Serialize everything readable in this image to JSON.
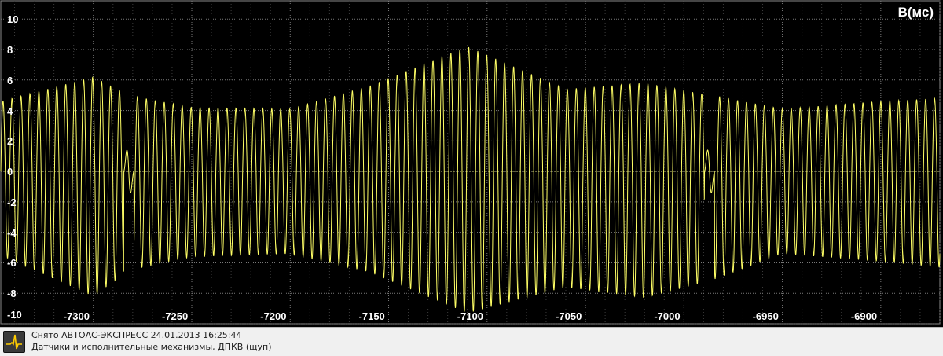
{
  "chart_data": {
    "type": "line",
    "unit_label": "В(мс)",
    "xlim": [
      -7347,
      -6870
    ],
    "ylim": [
      -10,
      11.2
    ],
    "y_ticks": [
      {
        "value": 10,
        "label": "10"
      },
      {
        "value": 8,
        "label": "8"
      },
      {
        "value": 6,
        "label": "6"
      },
      {
        "value": 4,
        "label": "4"
      },
      {
        "value": 2,
        "label": "2"
      },
      {
        "value": 0,
        "label": "0"
      },
      {
        "value": -2,
        "label": "-2"
      },
      {
        "value": -4,
        "label": "-4"
      },
      {
        "value": -6,
        "label": "-6"
      },
      {
        "value": -8,
        "label": "-8"
      },
      {
        "value": -10,
        "label": "-10"
      }
    ],
    "x_ticks": [
      {
        "value": -7300,
        "label": "-7300"
      },
      {
        "value": -7250,
        "label": "-7250"
      },
      {
        "value": -7200,
        "label": "-7200"
      },
      {
        "value": -7150,
        "label": "-7150"
      },
      {
        "value": -7100,
        "label": "-7100"
      },
      {
        "value": -7050,
        "label": "-7050"
      },
      {
        "value": -7000,
        "label": "-7000"
      },
      {
        "value": -6950,
        "label": "-6950"
      },
      {
        "value": -6900,
        "label": "-6900"
      }
    ],
    "grid": true,
    "series": [
      {
        "color": "#ffff66",
        "signal": "oscillating sine-like waveform, period ~4.55 ms, with two synchronization gaps",
        "gaps_center_x": [
          -7282,
          -6987
        ],
        "envelope_max_x": [
          -7347,
          -7300,
          -7282,
          -7250,
          -7200,
          -7160,
          -7110,
          -7060,
          -7020,
          -6987,
          -6950,
          -6900,
          -6870
        ],
        "envelope_max_y": [
          4.6,
          6.2,
          5.0,
          4.2,
          4.1,
          5.6,
          8.2,
          5.4,
          5.8,
          5.0,
          4.1,
          4.6,
          4.8
        ],
        "envelope_min_x": [
          -7347,
          -7300,
          -7282,
          -7250,
          -7200,
          -7160,
          -7110,
          -7060,
          -7020,
          -6987,
          -6950,
          -6900,
          -6870
        ],
        "envelope_min_y": [
          -5.5,
          -8.2,
          -6.5,
          -5.6,
          -5.4,
          -6.6,
          -9.3,
          -7.6,
          -8.3,
          -7.2,
          -5.4,
          -5.9,
          -6.3
        ]
      }
    ]
  },
  "status": {
    "line1": "Снято АВТОАС-ЭКСПРЕСС 24.01.2013 16:25:44",
    "line2": "Датчики и исполнительные механизмы, ДПКВ (щуп)"
  },
  "colors": {
    "plot_bg": "#000000",
    "grid": "#6c6c6c",
    "signal": "#ffff66",
    "text": "#ffffff"
  },
  "icons": {
    "app": "oscilloscope-waveform-icon"
  }
}
